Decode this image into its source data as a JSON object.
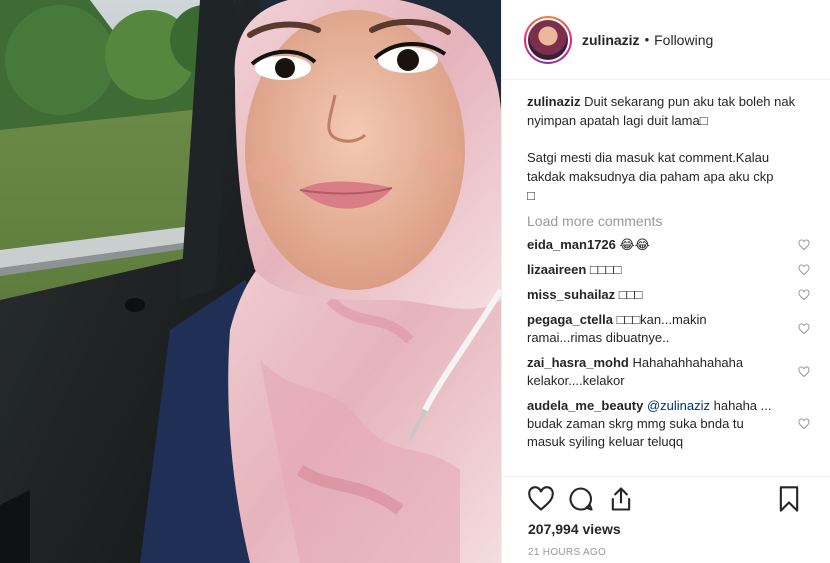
{
  "post": {
    "username": "zulinaziz",
    "separator": "•",
    "follow_status": "Following",
    "caption_user": "zulinaziz",
    "caption_line1": "Duit sekarang pun aku tak boleh nak nyimpan apatah lagi duit lama",
    "caption_line2": "Satgi mesti dia masuk kat comment.Kalau takdak maksudnya dia paham apa aku ckp",
    "caption_glyph": "□",
    "load_more": "Load more comments",
    "comments": [
      {
        "user": "eida_man1726",
        "text": "😂😂"
      },
      {
        "user": "lizaaireen",
        "text": "□□□□"
      },
      {
        "user": "miss_suhailaz",
        "text": "□□□"
      },
      {
        "user": "pegaga_ctella",
        "text": "□□□kan...makin ramai...rimas dibuatnye.."
      },
      {
        "user": "zai_hasra_mohd",
        "text": "Hahahahhahahaha kelakor....kelakor"
      },
      {
        "user": "audela_me_beauty",
        "mention": "@zulinaziz",
        "text": "hahaha ..."
      },
      {
        "user": "",
        "text": "budak zaman skrg mmg suka bnda tu masuk syiling keluar teluqq"
      }
    ],
    "views": "207,994 views",
    "time_ago": "21 HOURS AGO"
  },
  "icons": {
    "like": "heart-icon",
    "comment": "comment-icon",
    "share": "share-icon",
    "save": "bookmark-icon"
  },
  "colors": {
    "text": "#262626",
    "muted": "#999999",
    "mention": "#003569",
    "border": "#efefef"
  }
}
